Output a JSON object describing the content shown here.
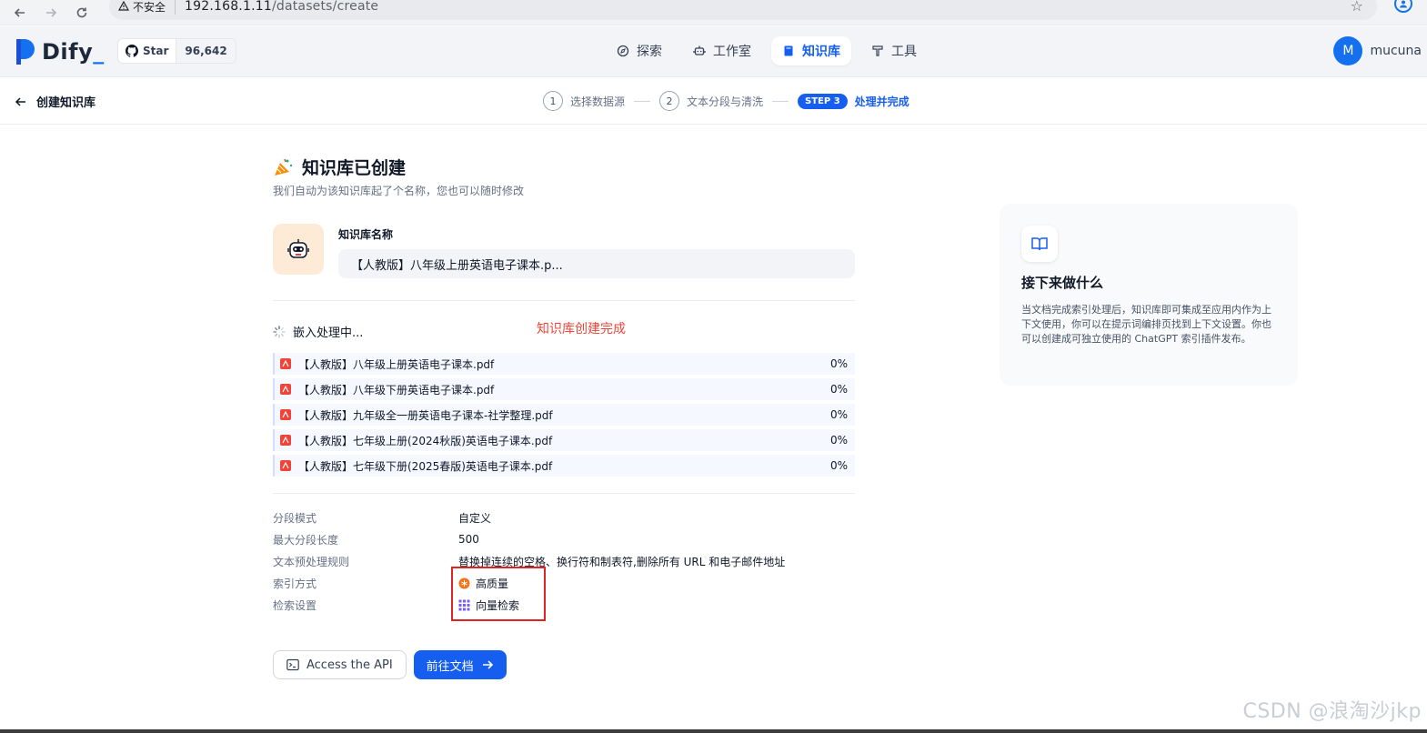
{
  "browser": {
    "insecure_label": "不安全",
    "url_host": "192.168.1.11",
    "url_path": "/datasets/create"
  },
  "app": {
    "logo_text": "Dify",
    "github": {
      "star_label": "Star",
      "star_count": "96,642"
    },
    "nav": [
      {
        "label": "探索",
        "icon": "compass-icon"
      },
      {
        "label": "工作室",
        "icon": "robot-icon"
      },
      {
        "label": "知识库",
        "icon": "book-icon",
        "active": true
      },
      {
        "label": "工具",
        "icon": "hammer-icon"
      }
    ],
    "user": {
      "avatar_letter": "M",
      "name": "mucuna"
    }
  },
  "subheader": {
    "back_label": "创建知识库",
    "steps": [
      {
        "num": "1",
        "label": "选择数据源"
      },
      {
        "num": "2",
        "label": "文本分段与清洗"
      },
      {
        "badge": "STEP 3",
        "label": "处理并完成"
      }
    ]
  },
  "main": {
    "title": "知识库已创建",
    "subtitle": "我们自动为该知识库起了个名称，您也可以随时修改",
    "kb_name_label": "知识库名称",
    "kb_name_value": "【人教版】八年级上册英语电子课本.p...",
    "embedding_status": "嵌入处理中...",
    "annotation": "知识库创建完成",
    "files": [
      {
        "name": "【人教版】八年级上册英语电子课本.pdf",
        "progress": "0%"
      },
      {
        "name": "【人教版】八年级下册英语电子课本.pdf",
        "progress": "0%"
      },
      {
        "name": "【人教版】九年级全一册英语电子课本-社学整理.pdf",
        "progress": "0%"
      },
      {
        "name": "【人教版】七年级上册(2024秋版)英语电子课本.pdf",
        "progress": "0%"
      },
      {
        "name": "【人教版】七年级下册(2025春版)英语电子课本.pdf",
        "progress": "0%"
      }
    ],
    "meta": [
      {
        "key": "分段模式",
        "value": "自定义"
      },
      {
        "key": "最大分段长度",
        "value": "500"
      },
      {
        "key": "文本预处理规则",
        "value": "替换掉连续的空格、换行符和制表符,删除所有 URL 和电子邮件地址"
      },
      {
        "key": "索引方式",
        "value": "高质量",
        "icon": "quality-icon"
      },
      {
        "key": "检索设置",
        "value": "向量检索",
        "icon": "vector-icon"
      }
    ],
    "btn_api": "Access the API",
    "btn_doc": "前往文档"
  },
  "info_card": {
    "title": "接下来做什么",
    "body": "当文档完成索引处理后，知识库即可集成至应用内作为上下文使用，你可以在提示词编排页找到上下文设置。你也可以创建成可独立使用的 ChatGPT 索引插件发布。"
  },
  "watermark": "CSDN @浪淘沙jkp",
  "colors": {
    "primary": "#155eef",
    "annotation": "#f04438",
    "highlight_border": "#e02424"
  }
}
